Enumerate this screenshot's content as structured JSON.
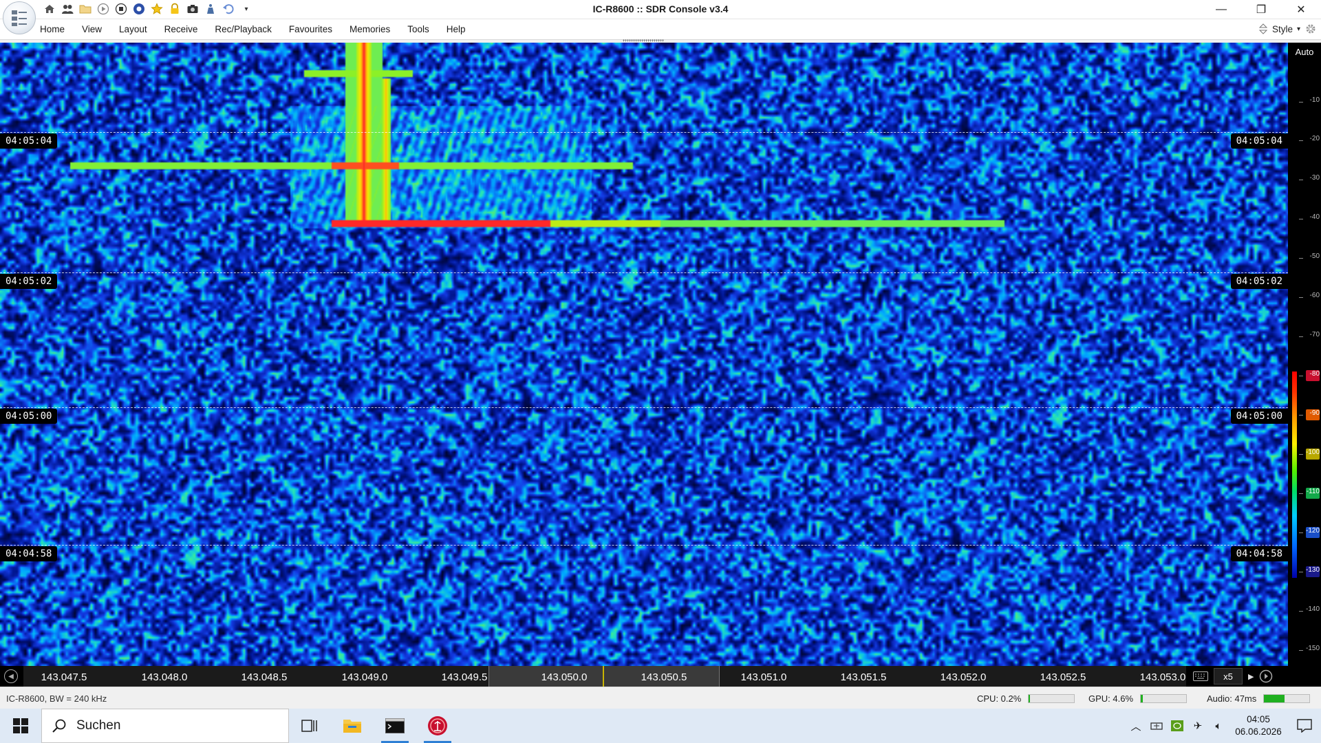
{
  "titlebar": {
    "title": "IC-R8600 :: SDR Console v3.4",
    "quick_access_icons": [
      "home-icon",
      "users-icon",
      "folder-icon",
      "play-icon",
      "stop-icon",
      "record-icon",
      "favourite-star-icon",
      "lock-icon",
      "camera-icon",
      "weight-icon",
      "undo-icon",
      "customize-dropdown-icon"
    ],
    "controls": {
      "minimize": "—",
      "restore": "❐",
      "close": "✕"
    }
  },
  "menu": {
    "items": [
      "Home",
      "View",
      "Layout",
      "Receive",
      "Rec/Playback",
      "Favourites",
      "Memories",
      "Tools",
      "Help"
    ],
    "style_label": "Style"
  },
  "waterfall": {
    "time_markers": [
      "04:05:04",
      "04:05:02",
      "04:05:00",
      "04:04:58"
    ],
    "auto_label": "Auto",
    "db_scale": [
      "-10",
      "-20",
      "-30",
      "-40",
      "-50",
      "-60",
      "-70",
      "-80",
      "-90",
      "-100",
      "-110",
      "-120",
      "-130",
      "-140",
      "-150"
    ],
    "db_scale_colors": {
      "-80": "#c8102e",
      "-90": "#e05a00",
      "-100": "#b8a800",
      "-110": "#12a84a",
      "-120": "#1a4fc8",
      "-130": "#1a1a8a"
    }
  },
  "frequency": {
    "labels": [
      "143.047.5",
      "143.048.0",
      "143.048.5",
      "143.049.0",
      "143.049.5",
      "143.050.0",
      "143.050.5",
      "143.051.0",
      "143.051.5",
      "143.052.0",
      "143.052.5",
      "143.053.0"
    ],
    "zoom": "x5"
  },
  "status": {
    "device": "IC-R8600, BW = 240 kHz",
    "cpu_label": "CPU: 0.2%",
    "cpu_level": 0.002,
    "gpu_label": "GPU: 4.6%",
    "gpu_level": 0.046,
    "audio_label": "Audio: 47ms",
    "audio_level": 0.45
  },
  "taskbar": {
    "search_placeholder": "Suchen",
    "time": "04:05",
    "date": "06.06.2026"
  }
}
